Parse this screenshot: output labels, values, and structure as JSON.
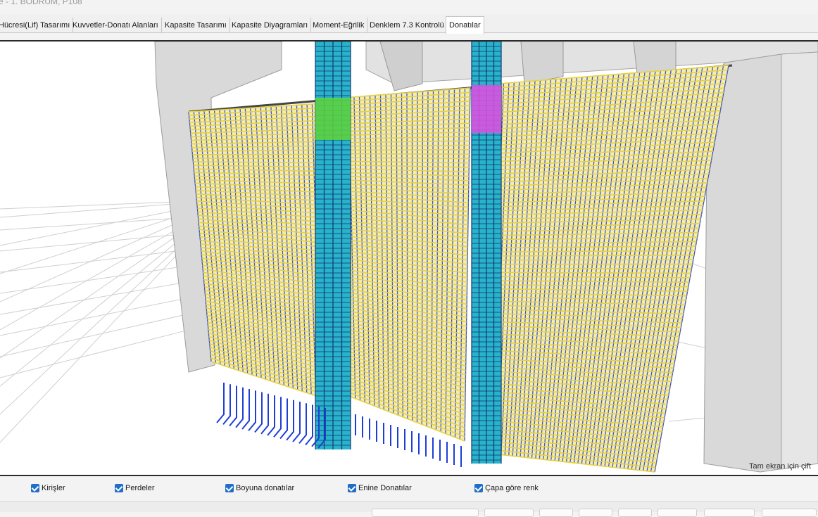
{
  "window": {
    "title": "e - 1. BODRUM, P108"
  },
  "tabs": [
    {
      "label": "Hücresi(Lif) Tasarımı",
      "active": false
    },
    {
      "label": "Kuvvetler-Donatı Alanları",
      "active": false
    },
    {
      "label": "Kapasite Tasarımı",
      "active": false
    },
    {
      "label": "Kapasite Diyagramları",
      "active": false
    },
    {
      "label": "Moment-Eğrilik",
      "active": false
    },
    {
      "label": "Denklem 7.3 Kontrolü",
      "active": false
    },
    {
      "label": "Donatılar",
      "active": true
    }
  ],
  "viewport": {
    "hint": "Tam ekran için çift"
  },
  "options": [
    {
      "label": "Kirişler",
      "checked": true
    },
    {
      "label": "Perdeler",
      "checked": true
    },
    {
      "label": "Boyuna donatılar",
      "checked": true
    },
    {
      "label": "Enine Donatılar",
      "checked": true
    },
    {
      "label": "Çapa göre renk",
      "checked": true
    }
  ],
  "colors": {
    "horizontal_rebar": "#e8d23a",
    "vertical_rebar": "#1e3fd6",
    "column_rebar": "#27b3c9",
    "highlight_green": "#5fd43a",
    "highlight_magenta": "#e34ee3",
    "structure_gray": "#d9d9d9",
    "checkbox_accent": "#1f6fc9"
  }
}
